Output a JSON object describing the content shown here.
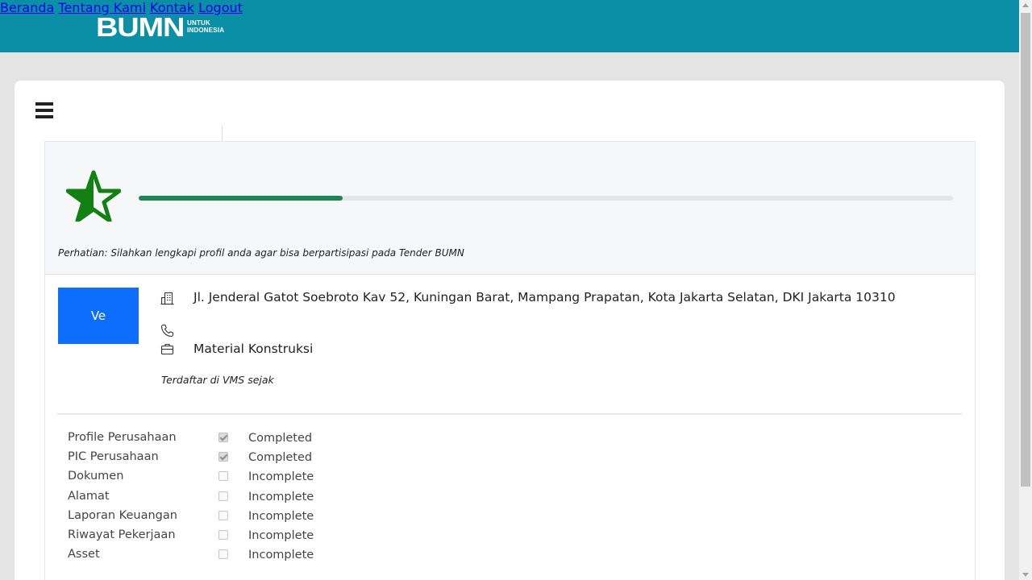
{
  "brand": {
    "logo_main": "BUMN",
    "logo_sub_1": "UNTUK",
    "logo_sub_2": "INDONESIA"
  },
  "nav": {
    "items": [
      {
        "label": "Beranda"
      },
      {
        "label": "Tentang Kami"
      },
      {
        "label": "Kontak"
      },
      {
        "label": "Logout"
      }
    ]
  },
  "colors": {
    "navbar": "#0a8fa7",
    "progress": "#1a8754",
    "star": "#128012",
    "avatar": "#0d6efd"
  },
  "profile": {
    "progress_fraction": 0.25,
    "notice": "Perhatian: Silahkan lengkapi profil anda agar bisa berpartisipasi pada Tender BUMN",
    "avatar_text": "Ve",
    "address": "Jl. Jenderal Gatot Soebroto Kav 52, Kuningan Barat, Mampang Prapatan, Kota Jakarta Selatan, DKI Jakarta 10310",
    "phone": "",
    "category": "Material Konstruksi",
    "registered": "Terdaftar di VMS sejak"
  },
  "status": [
    {
      "label": "Profile Perusahaan",
      "checked": true,
      "value": "Completed"
    },
    {
      "label": "PIC Perusahaan",
      "checked": true,
      "value": "Completed"
    },
    {
      "label": "Dokumen",
      "checked": false,
      "value": "Incomplete"
    },
    {
      "label": "Alamat",
      "checked": false,
      "value": "Incomplete"
    },
    {
      "label": "Laporan Keuangan",
      "checked": false,
      "value": "Incomplete"
    },
    {
      "label": "Riwayat Pekerjaan",
      "checked": false,
      "value": "Incomplete"
    },
    {
      "label": "Asset",
      "checked": false,
      "value": "Incomplete"
    }
  ],
  "icons": {
    "menu": "hamburger-icon",
    "rating": "star-icon",
    "address": "building-icon",
    "phone": "phone-icon",
    "category": "briefcase-icon"
  }
}
